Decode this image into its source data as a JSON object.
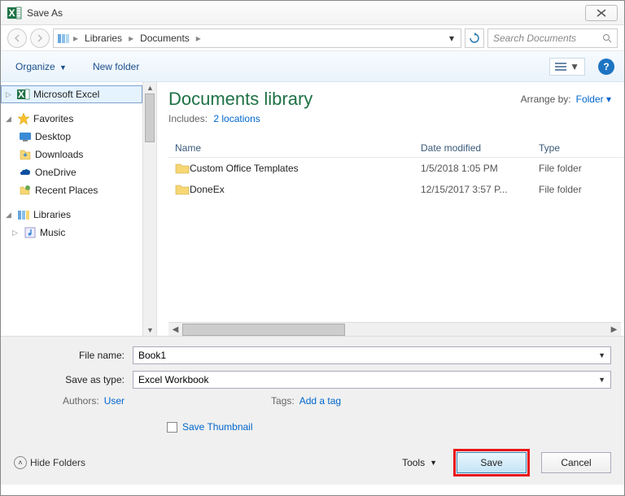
{
  "window": {
    "title": "Save As"
  },
  "breadcrumb": {
    "root_icon": "libraries-icon",
    "items": [
      "Libraries",
      "Documents"
    ],
    "search_placeholder": "Search Documents"
  },
  "toolbar": {
    "organize": "Organize",
    "newfolder": "New folder"
  },
  "sidebar": {
    "top": {
      "label": "Microsoft Excel"
    },
    "favorites": {
      "label": "Favorites",
      "items": [
        {
          "label": "Desktop",
          "icon": "desktop-icon"
        },
        {
          "label": "Downloads",
          "icon": "downloads-icon"
        },
        {
          "label": "OneDrive",
          "icon": "onedrive-icon"
        },
        {
          "label": "Recent Places",
          "icon": "recent-icon"
        }
      ]
    },
    "libraries": {
      "label": "Libraries",
      "items": [
        {
          "label": "Music",
          "icon": "music-icon"
        }
      ]
    }
  },
  "library": {
    "title": "Documents library",
    "includes_label": "Includes:",
    "includes_link": "2 locations",
    "arrange_label": "Arrange by:",
    "arrange_value": "Folder"
  },
  "columns": {
    "name": "Name",
    "date": "Date modified",
    "type": "Type"
  },
  "files": [
    {
      "name": "Custom Office Templates",
      "date": "1/5/2018 1:05 PM",
      "type": "File folder"
    },
    {
      "name": "DoneEx",
      "date": "12/15/2017 3:57 P...",
      "type": "File folder"
    }
  ],
  "form": {
    "filename_label": "File name:",
    "filename_value": "Book1",
    "type_label": "Save as type:",
    "type_value": "Excel Workbook",
    "authors_label": "Authors:",
    "authors_value": "User",
    "tags_label": "Tags:",
    "tags_value": "Add a tag",
    "thumbnail_label": "Save Thumbnail"
  },
  "buttons": {
    "hide_folders": "Hide Folders",
    "tools": "Tools",
    "save": "Save",
    "cancel": "Cancel"
  }
}
